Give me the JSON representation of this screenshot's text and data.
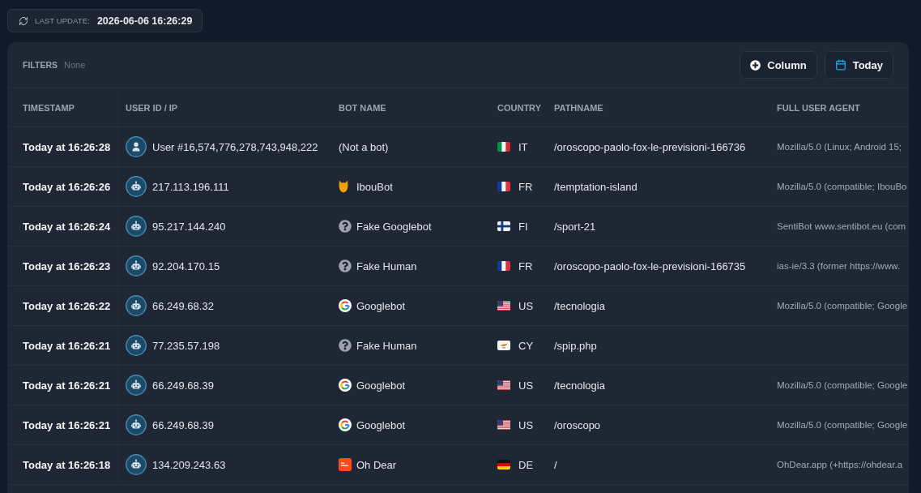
{
  "last_update": {
    "label": "LAST UPDATE:",
    "value": "2026-06-06 16:26:29"
  },
  "filters": {
    "label": "FILTERS",
    "value": "None"
  },
  "buttons": [
    {
      "kind": "add",
      "label": "Column"
    },
    {
      "kind": "calendar",
      "label": "Today"
    }
  ],
  "table": {
    "columns": [
      "TIMESTAMP",
      "USER ID / IP",
      "BOT NAME",
      "COUNTRY",
      "PATHNAME",
      "FULL USER AGENT"
    ],
    "rows": [
      {
        "timestamp": "Today at 16:26:28",
        "visitor": {
          "kind": "user",
          "label": "User #16,574,776,278,743,948,222"
        },
        "bot": {
          "kind": "none",
          "name": "(Not a bot)"
        },
        "country": {
          "kind": "italy",
          "code": "IT"
        },
        "pathname": "/oroscopo-paolo-fox-le-previsioni-166736",
        "user_agent": "Mozilla/5.0 (Linux; Android 15;"
      },
      {
        "timestamp": "Today at 16:26:26",
        "visitor": {
          "kind": "bot",
          "label": "217.113.196.111"
        },
        "bot": {
          "kind": "owl",
          "name": "IbouBot"
        },
        "country": {
          "kind": "france",
          "code": "FR"
        },
        "pathname": "/temptation-island",
        "user_agent": "Mozilla/5.0 (compatible; IbouBo"
      },
      {
        "timestamp": "Today at 16:26:24",
        "visitor": {
          "kind": "bot",
          "label": "95.217.144.240"
        },
        "bot": {
          "kind": "unknown",
          "name": "Fake Googlebot"
        },
        "country": {
          "kind": "finland",
          "code": "FI"
        },
        "pathname": "/sport-21",
        "user_agent": "SentiBot www.sentibot.eu (com"
      },
      {
        "timestamp": "Today at 16:26:23",
        "visitor": {
          "kind": "bot",
          "label": "92.204.170.15"
        },
        "bot": {
          "kind": "unknown",
          "name": "Fake Human"
        },
        "country": {
          "kind": "france",
          "code": "FR"
        },
        "pathname": "/oroscopo-paolo-fox-le-previsioni-166735",
        "user_agent": "ias-ie/3.3 (former https://www."
      },
      {
        "timestamp": "Today at 16:26:22",
        "visitor": {
          "kind": "bot",
          "label": "66.249.68.32"
        },
        "bot": {
          "kind": "google",
          "name": "Googlebot"
        },
        "country": {
          "kind": "usa",
          "code": "US"
        },
        "pathname": "/tecnologia",
        "user_agent": "Mozilla/5.0 (compatible; Google"
      },
      {
        "timestamp": "Today at 16:26:21",
        "visitor": {
          "kind": "bot",
          "label": "77.235.57.198"
        },
        "bot": {
          "kind": "unknown",
          "name": "Fake Human"
        },
        "country": {
          "kind": "cyprus",
          "code": "CY"
        },
        "pathname": "/spip.php"
      },
      {
        "timestamp": "Today at 16:26:21",
        "visitor": {
          "kind": "bot",
          "label": "66.249.68.39"
        },
        "bot": {
          "kind": "google",
          "name": "Googlebot"
        },
        "country": {
          "kind": "usa",
          "code": "US"
        },
        "pathname": "/tecnologia",
        "user_agent": "Mozilla/5.0 (compatible; Google"
      },
      {
        "timestamp": "Today at 16:26:21",
        "visitor": {
          "kind": "bot",
          "label": "66.249.68.39"
        },
        "bot": {
          "kind": "google",
          "name": "Googlebot"
        },
        "country": {
          "kind": "usa",
          "code": "US"
        },
        "pathname": "/oroscopo",
        "user_agent": "Mozilla/5.0 (compatible; Google"
      },
      {
        "timestamp": "Today at 16:26:18",
        "visitor": {
          "kind": "bot",
          "label": "134.209.243.63"
        },
        "bot": {
          "kind": "ohdear",
          "name": "Oh Dear"
        },
        "country": {
          "kind": "germany",
          "code": "DE"
        },
        "pathname": "/",
        "user_agent": "OhDear.app (+https://ohdear.a"
      }
    ]
  }
}
